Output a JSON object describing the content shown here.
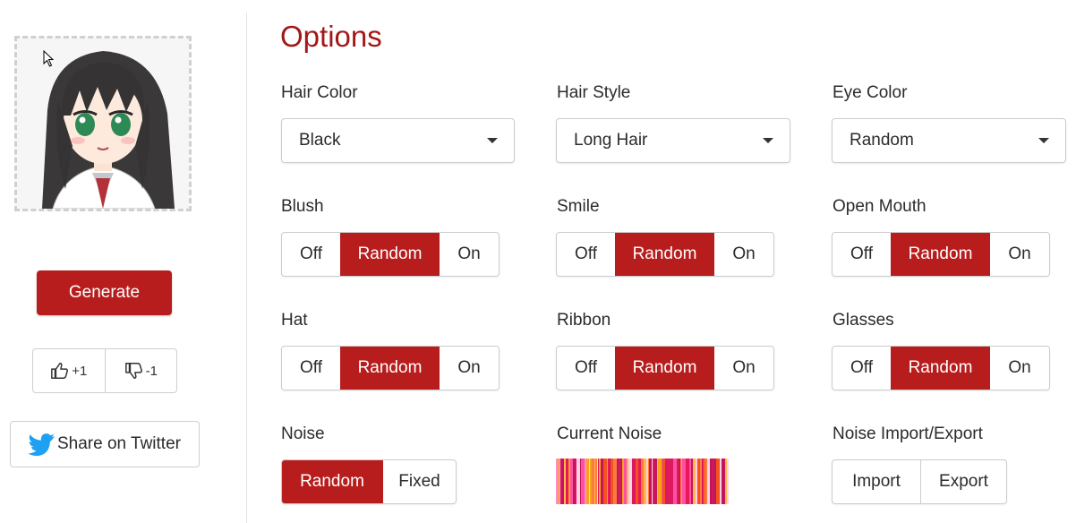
{
  "sidebar": {
    "generate_label": "Generate",
    "upvote_label": "+1",
    "downvote_label": "-1",
    "share_label": "Share on Twitter"
  },
  "options": {
    "title": "Options",
    "hair_color": {
      "label": "Hair Color",
      "value": "Black"
    },
    "hair_style": {
      "label": "Hair Style",
      "value": "Long Hair"
    },
    "eye_color": {
      "label": "Eye Color",
      "value": "Random"
    },
    "toggles": [
      {
        "label": "Blush",
        "choices": [
          "Off",
          "Random",
          "On"
        ],
        "selected": "Random"
      },
      {
        "label": "Smile",
        "choices": [
          "Off",
          "Random",
          "On"
        ],
        "selected": "Random"
      },
      {
        "label": "Open Mouth",
        "choices": [
          "Off",
          "Random",
          "On"
        ],
        "selected": "Random"
      },
      {
        "label": "Hat",
        "choices": [
          "Off",
          "Random",
          "On"
        ],
        "selected": "Random"
      },
      {
        "label": "Ribbon",
        "choices": [
          "Off",
          "Random",
          "On"
        ],
        "selected": "Random"
      },
      {
        "label": "Glasses",
        "choices": [
          "Off",
          "Random",
          "On"
        ],
        "selected": "Random"
      }
    ],
    "noise": {
      "label": "Noise",
      "choices": [
        "Random",
        "Fixed"
      ],
      "selected": "Random"
    },
    "current_noise": {
      "label": "Current Noise"
    },
    "noise_io": {
      "label": "Noise Import/Export",
      "import_label": "Import",
      "export_label": "Export"
    }
  },
  "colors": {
    "accent": "#b81d1d",
    "title": "#a41717",
    "border": "#cccccc"
  },
  "icons": [
    "cursor-icon",
    "thumbs-up-icon",
    "thumbs-down-icon",
    "twitter-bird-icon",
    "caret-down-icon"
  ]
}
